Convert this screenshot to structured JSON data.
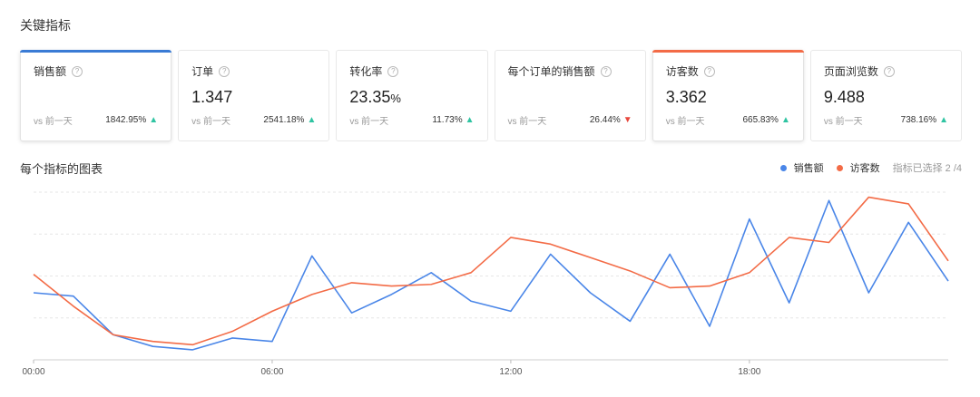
{
  "header": {
    "title": "关键指标"
  },
  "cards": [
    {
      "label": "销售额",
      "value": "",
      "unit": "",
      "vs_label": "vs 前一天",
      "change": "1842.95%",
      "trend": "up",
      "active": true,
      "accent": "#3a7bd5"
    },
    {
      "label": "订单",
      "value": "1.347",
      "unit": "",
      "vs_label": "vs 前一天",
      "change": "2541.18%",
      "trend": "up",
      "active": false,
      "accent": ""
    },
    {
      "label": "转化率",
      "value": "23.35",
      "unit": "%",
      "vs_label": "vs 前一天",
      "change": "11.73%",
      "trend": "up",
      "active": false,
      "accent": ""
    },
    {
      "label": "每个订单的销售额",
      "value": "",
      "unit": "",
      "vs_label": "vs 前一天",
      "change": "26.44%",
      "trend": "down",
      "active": false,
      "accent": ""
    },
    {
      "label": "访客数",
      "value": "3.362",
      "unit": "",
      "vs_label": "vs 前一天",
      "change": "665.83%",
      "trend": "up",
      "active": true,
      "accent": "#f36b46"
    },
    {
      "label": "页面浏览数",
      "value": "9.488",
      "unit": "",
      "vs_label": "vs 前一天",
      "change": "738.16%",
      "trend": "up",
      "active": false,
      "accent": ""
    }
  ],
  "chart_section": {
    "title": "每个指标的图表",
    "selected_count": "指标已选择 2 /4"
  },
  "colors": {
    "sales": "#4a86e8",
    "visitors": "#f36b46",
    "up": "#2fc4a2",
    "down": "#e8473d"
  },
  "icons": {
    "help": "help-icon",
    "up": "arrow-up-icon",
    "down": "arrow-down-icon"
  },
  "chart_data": {
    "type": "line",
    "x": [
      0,
      1,
      2,
      3,
      4,
      5,
      6,
      7,
      8,
      9,
      10,
      11,
      12,
      13,
      14,
      15,
      16,
      17,
      18,
      19,
      20,
      21,
      22,
      23
    ],
    "x_ticks": [
      {
        "value": 0,
        "label": "00:00"
      },
      {
        "value": 6,
        "label": "06:00"
      },
      {
        "value": 12,
        "label": "12:00"
      },
      {
        "value": 18,
        "label": "18:00"
      }
    ],
    "ylim": [
      0,
      100
    ],
    "grid": true,
    "legend": "top-right",
    "series": [
      {
        "name": "销售额",
        "color": "#4a86e8",
        "values": [
          40,
          38,
          15,
          8,
          6,
          13,
          11,
          62,
          28,
          39,
          52,
          35,
          29,
          63,
          40,
          23,
          63,
          20,
          84,
          34,
          95,
          40,
          82,
          47
        ]
      },
      {
        "name": "访客数",
        "color": "#f36b46",
        "values": [
          51,
          32,
          15,
          11,
          9,
          17,
          29,
          39,
          46,
          44,
          45,
          52,
          73,
          69,
          61,
          53,
          43,
          44,
          52,
          73,
          70,
          97,
          93,
          59
        ]
      }
    ]
  }
}
